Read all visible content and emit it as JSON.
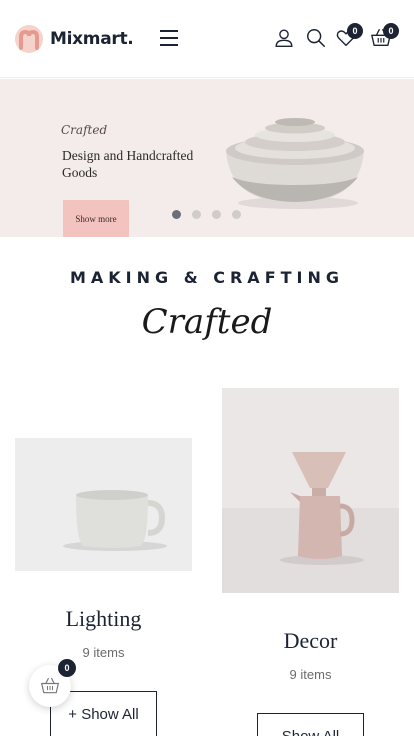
{
  "header": {
    "brand": "Mixmart.",
    "wishlist_count": "0",
    "cart_count": "0"
  },
  "hero": {
    "script_label": "Crafted",
    "title": "Design and Handcrafted Goods",
    "button_label": "Show more",
    "slides_total": 4,
    "active_slide": 1
  },
  "section": {
    "heading": "MAKING & CRAFTING",
    "script": "Crafted"
  },
  "categories": [
    {
      "title": "Lighting",
      "count": "9 items",
      "button": "+ Show All"
    },
    {
      "title": "Decor",
      "count": "9 items",
      "button": "Show All"
    }
  ],
  "floating_cart": {
    "count": "0"
  },
  "colors": {
    "brand_dark": "#1c2434",
    "accent_pink": "#f2c3bf",
    "hero_bg": "#f3ecea",
    "logo_accent": "#e9a9a0"
  }
}
